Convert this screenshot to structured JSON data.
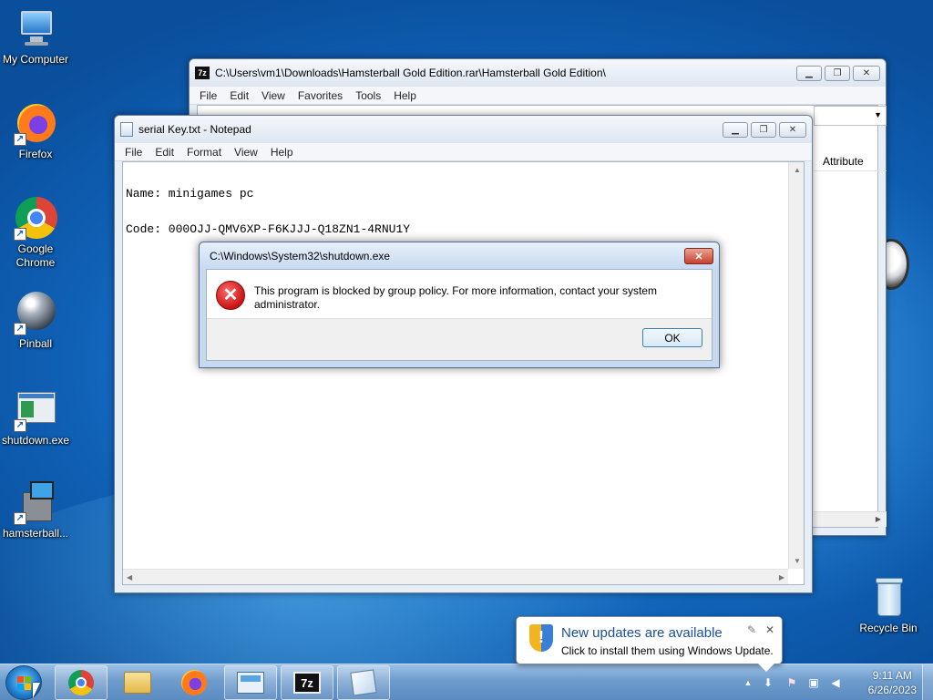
{
  "desktop_icons": [
    {
      "label": "My Computer"
    },
    {
      "label": "Firefox"
    },
    {
      "label": "Google Chrome"
    },
    {
      "label": "Pinball"
    },
    {
      "label": "shutdown.exe"
    },
    {
      "label": "hamsterball..."
    },
    {
      "label": "Recycle Bin"
    }
  ],
  "sevenzip_window": {
    "title": "C:\\Users\\vm1\\Downloads\\Hamsterball Gold Edition.rar\\Hamsterball Gold Edition\\",
    "menu": [
      "File",
      "Edit",
      "View",
      "Favorites",
      "Tools",
      "Help"
    ],
    "column_header": "Attribute",
    "icon_text": "7z"
  },
  "notepad_window": {
    "title": "serial Key.txt - Notepad",
    "menu": [
      "File",
      "Edit",
      "Format",
      "View",
      "Help"
    ],
    "content_line1": "Name: minigames pc",
    "content_line2": "Code: 000OJJ-QMV6XP-F6KJJJ-Q18ZN1-4RNU1Y"
  },
  "error_dialog": {
    "title": "C:\\Windows\\System32\\shutdown.exe",
    "message": "This program is blocked by group policy. For more information, contact your system administrator.",
    "ok_label": "OK"
  },
  "notification": {
    "title": "New updates are available",
    "subtitle": "Click to install them using Windows Update."
  },
  "taskbar": {
    "apps": [
      "chrome",
      "explorer",
      "firefox",
      "control-panel",
      "7-zip",
      "notepad"
    ],
    "clock_time": "9:11 AM",
    "clock_date": "6/26/2023"
  },
  "colors": {
    "desktop_blue": "#1d7fd6",
    "error_red": "#c81414",
    "notification_title": "#1a4f9c"
  }
}
